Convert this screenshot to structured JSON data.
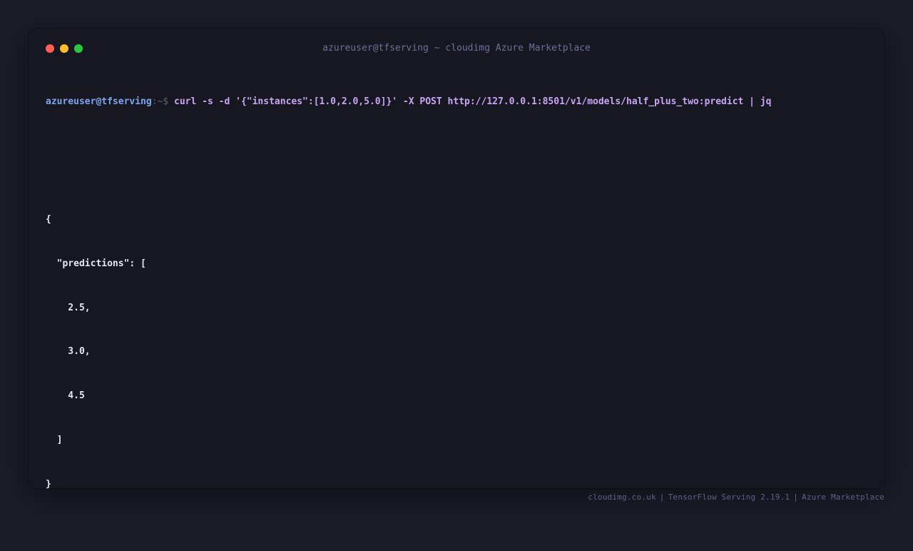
{
  "window": {
    "title": "azureuser@tfserving ~ cloudimg Azure Marketplace",
    "controls": {
      "close_color": "#ff5f57",
      "minimize_color": "#febc2e",
      "maximize_color": "#28c840"
    }
  },
  "terminal": {
    "prompt_user": "azureuser@tfserving",
    "prompt_path": ":~$",
    "command": "curl -s -d '{\"instances\":[1.0,2.0,5.0]}' -X POST http://127.0.0.1:8501/v1/models/half_plus_two:predict | jq",
    "output_lines": [
      "{",
      "  \"predictions\": [",
      "    2.5,",
      "    3.0,",
      "    4.5",
      "  ]",
      "}"
    ]
  },
  "footer": {
    "site": "cloudimg.co.uk",
    "product": "TensorFlow Serving 2.19.1",
    "marketplace": "Azure Marketplace",
    "separator": "|"
  }
}
